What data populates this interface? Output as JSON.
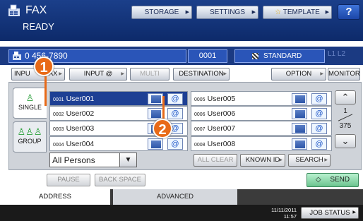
{
  "header": {
    "title": "FAX",
    "status": "READY",
    "storage_label": "STORAGE",
    "settings_label": "SETTINGS",
    "template_label": "TEMPLATE",
    "help_label": "?"
  },
  "faxline": {
    "number": "0    456-7890",
    "count": "0001",
    "resolution": "STANDARD",
    "lines": "L1 L2"
  },
  "toolbar": {
    "input_fax": "INPU",
    "input_fax_tail": "AX",
    "input_email": "INPUT @",
    "multi": "MULTI",
    "destination": "DESTINATION",
    "option": "OPTION",
    "monitor": "MONITOR"
  },
  "sidetabs": {
    "single": "SINGLE",
    "group": "GROUP"
  },
  "entries": [
    {
      "num": "0001",
      "name": "User001",
      "selected": true
    },
    {
      "num": "0002",
      "name": "User002",
      "selected": false
    },
    {
      "num": "0003",
      "name": "User003",
      "selected": false
    },
    {
      "num": "0004",
      "name": "User004",
      "selected": false
    },
    {
      "num": "0005",
      "name": "User005",
      "selected": false
    },
    {
      "num": "0006",
      "name": "User006",
      "selected": false
    },
    {
      "num": "0007",
      "name": "User007",
      "selected": false
    },
    {
      "num": "0008",
      "name": "User008",
      "selected": false
    }
  ],
  "pager": {
    "current": "1",
    "total": "375"
  },
  "filter": {
    "value": "All Persons",
    "all_clear": "ALL CLEAR",
    "known_id": "KNOWN ID",
    "search": "SEARCH"
  },
  "actions": {
    "pause": "PAUSE",
    "backspace": "BACK SPACE",
    "send": "SEND"
  },
  "bottom_tabs": {
    "address": "ADDRESS",
    "advanced": "ADVANCED"
  },
  "footer": {
    "date": "11/11/2011",
    "time": "11:57",
    "job_status": "JOB STATUS"
  },
  "markers": {
    "one": "1",
    "two": "2"
  },
  "colors": {
    "header": "#1b3f8a",
    "selected": "#1d3f94",
    "marker": "#e86a18",
    "send": "#6cc48f"
  },
  "icons": {
    "fax": "fax-icon",
    "email": "at-icon",
    "star": "star-icon",
    "single": "person-icon",
    "group": "group-icon"
  }
}
